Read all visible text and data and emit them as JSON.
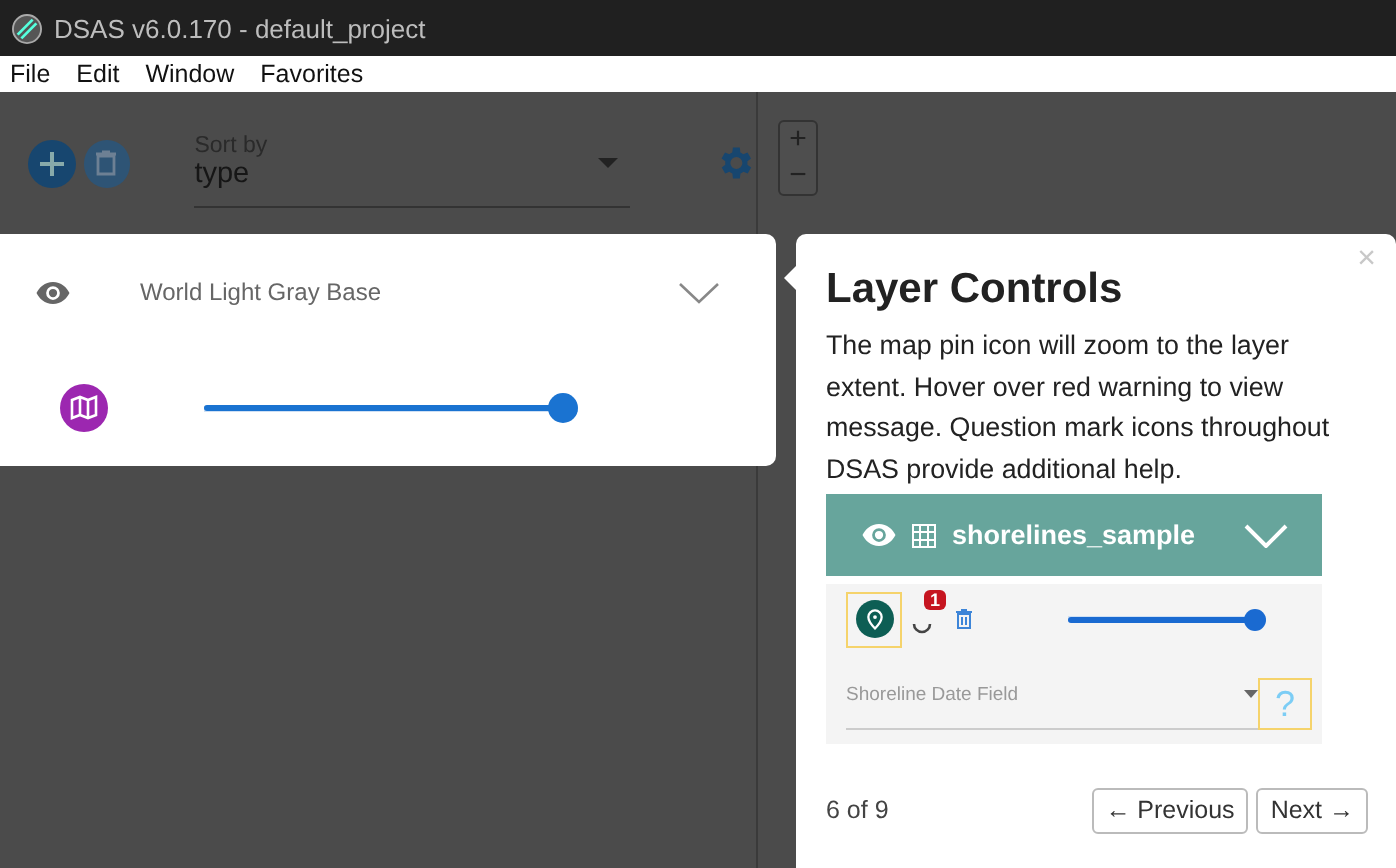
{
  "window": {
    "title": "DSAS v6.0.170 - default_project"
  },
  "menu": [
    "File",
    "Edit",
    "Window",
    "Favorites"
  ],
  "toolbar": {
    "sort_label": "Sort by",
    "sort_value": "type"
  },
  "map_zoom": [
    "+",
    "−"
  ],
  "layer": {
    "name": "World Light Gray Base",
    "opacity": {
      "level": 1
    }
  },
  "tour": {
    "close": "×",
    "title": "Layer Controls",
    "body": "The map pin icon will zoom to the layer extent. Hover over red warning to view message. Question mark icons throughout DSAS provide additional help.",
    "example": {
      "layer_name": "shorelines_sample",
      "warning_count": "1",
      "field_label": "Shoreline Date Field",
      "help": "?",
      "opacity": {
        "level": 1
      }
    },
    "progress": "6 of 9",
    "buttons": [
      "← Previous",
      "Next →"
    ]
  }
}
